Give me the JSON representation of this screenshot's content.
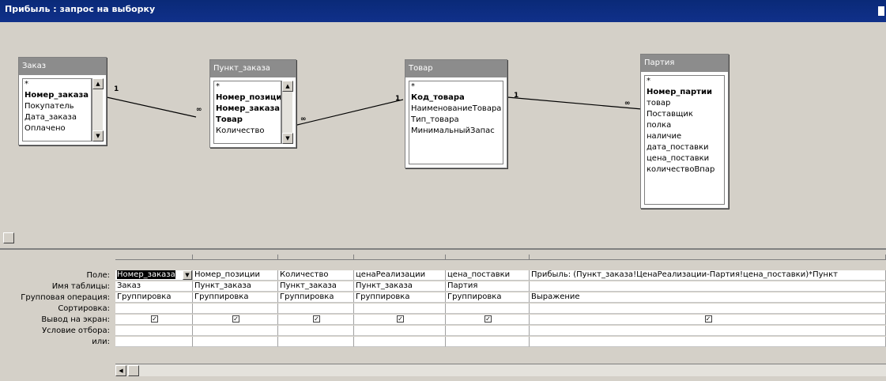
{
  "window": {
    "title": "Прибыль : запрос на выборку"
  },
  "tables": [
    {
      "name": "Заказ",
      "fields": [
        {
          "label": "*",
          "bold": false
        },
        {
          "label": "Номер_заказа",
          "bold": true
        },
        {
          "label": "Покупатель",
          "bold": false
        },
        {
          "label": "Дата_заказа",
          "bold": false
        },
        {
          "label": "Оплачено",
          "bold": false
        }
      ]
    },
    {
      "name": "Пункт_заказа",
      "fields": [
        {
          "label": "*",
          "bold": false
        },
        {
          "label": "Номер_позиции",
          "bold": true
        },
        {
          "label": "Номер_заказа",
          "bold": true
        },
        {
          "label": "Товар",
          "bold": true
        },
        {
          "label": "Количество",
          "bold": false
        }
      ]
    },
    {
      "name": "Товар",
      "fields": [
        {
          "label": "*",
          "bold": false
        },
        {
          "label": "Код_товара",
          "bold": true
        },
        {
          "label": "НаименованиеТовара",
          "bold": false
        },
        {
          "label": "Тип_товара",
          "bold": false
        },
        {
          "label": "МинимальныйЗапас",
          "bold": false
        }
      ]
    },
    {
      "name": "Партия",
      "fields": [
        {
          "label": "*",
          "bold": false
        },
        {
          "label": "Номер_партии",
          "bold": true
        },
        {
          "label": "товар",
          "bold": false
        },
        {
          "label": "Поставщик",
          "bold": false
        },
        {
          "label": "полка",
          "bold": false
        },
        {
          "label": "наличие",
          "bold": false
        },
        {
          "label": "дата_поставки",
          "bold": false
        },
        {
          "label": "цена_поставки",
          "bold": false
        },
        {
          "label": "количествоВпар",
          "bold": false
        }
      ]
    }
  ],
  "relations": [
    {
      "one": "1",
      "many": "∞"
    },
    {
      "one": "1",
      "many": "∞"
    },
    {
      "one": "1",
      "many": "∞"
    }
  ],
  "grid": {
    "row_labels": [
      "Поле:",
      "Имя таблицы:",
      "Групповая операция:",
      "Сортировка:",
      "Вывод на экран:",
      "Условие отбора:",
      "или:"
    ],
    "columns": [
      {
        "field": "Номер_заказа",
        "table": "Заказ",
        "group": "Группировка",
        "sort": "",
        "show": true,
        "criteria": "",
        "or": ""
      },
      {
        "field": "Номер_позиции",
        "table": "Пункт_заказа",
        "group": "Группировка",
        "sort": "",
        "show": true,
        "criteria": "",
        "or": ""
      },
      {
        "field": "Количество",
        "table": "Пункт_заказа",
        "group": "Группировка",
        "sort": "",
        "show": true,
        "criteria": "",
        "or": ""
      },
      {
        "field": "ценаРеализации",
        "table": "Пункт_заказа",
        "group": "Группировка",
        "sort": "",
        "show": true,
        "criteria": "",
        "or": ""
      },
      {
        "field": "цена_поставки",
        "table": "Партия",
        "group": "Группировка",
        "sort": "",
        "show": true,
        "criteria": "",
        "or": ""
      },
      {
        "field": "Прибыль: (Пункт_заказа!ЦенаРеализации-Партия!цена_поставки)*Пункт",
        "table": "",
        "group": "Выражение",
        "sort": "",
        "show": true,
        "criteria": "",
        "or": ""
      }
    ]
  }
}
